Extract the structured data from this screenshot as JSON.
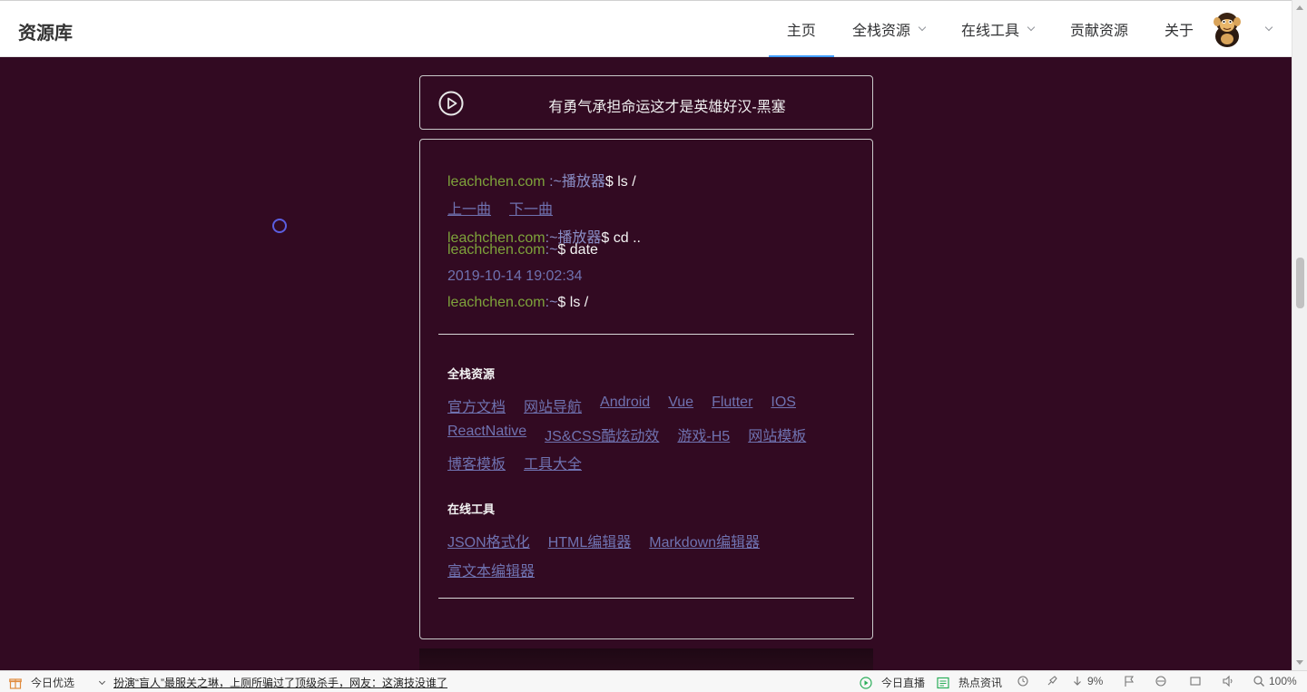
{
  "header": {
    "logo": "资源库",
    "nav": [
      {
        "label": "主页",
        "active": true,
        "dropdown": false
      },
      {
        "label": "全栈资源",
        "active": false,
        "dropdown": true
      },
      {
        "label": "在线工具",
        "active": false,
        "dropdown": true
      },
      {
        "label": "贡献资源",
        "active": false,
        "dropdown": false
      },
      {
        "label": "关于",
        "active": false,
        "dropdown": false
      }
    ],
    "accent_color": "#409eff"
  },
  "player": {
    "song_title": "有勇气承担命运这才是英雄好汉-黑塞",
    "icon": "play-circle-icon"
  },
  "terminal": {
    "line1": {
      "host": "leachchen.com",
      "path": " :~播放器",
      "cmd": "$ ls /"
    },
    "controls": {
      "prev": "上一曲",
      "next": "下一曲"
    },
    "line2": {
      "host": "leachchen.com",
      "path": ":~播放器",
      "cmd": "$ cd .."
    },
    "line3": {
      "host": "leachchen.com",
      "path": ":~",
      "cmd": "$ date"
    },
    "date_output": "2019-10-14 19:02:34",
    "line4": {
      "host": "leachchen.com",
      "path": ":~",
      "cmd": "$ ls /"
    },
    "fullstack": {
      "title": "全栈资源",
      "links": [
        "官方文档",
        "网站导航",
        "Android",
        "Vue",
        "Flutter",
        "IOS",
        "ReactNative",
        "JS&CSS酷炫动效",
        "游戏-H5",
        "网站模板",
        "博客模板",
        "工具大全"
      ]
    },
    "tools": {
      "title": "在线工具",
      "links": [
        "JSON格式化",
        "HTML编辑器",
        "Markdown编辑器",
        "富文本编辑器"
      ]
    }
  },
  "colors": {
    "background": "#320a22",
    "host": "#7ea33b",
    "link": "#6f72b0"
  },
  "statusbar": {
    "today_pick": "今日优选",
    "news": "扮演“盲人”最服关之琳，上厕所骗过了顶级杀手，网友：这演技没谁了",
    "live": "今日直播",
    "hot": "热点资讯",
    "download_pct": "9%",
    "zoom": "100%"
  }
}
